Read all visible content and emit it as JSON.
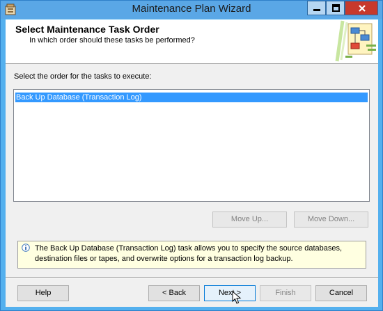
{
  "window": {
    "title": "Maintenance Plan Wizard",
    "controls": [
      {
        "name": "minimize-button",
        "icon": "minimize-icon"
      },
      {
        "name": "maximize-button",
        "icon": "maximize-icon"
      },
      {
        "name": "close-button",
        "icon": "close-icon"
      }
    ],
    "close_color": "#c7392c",
    "title_bar_color": "#5aa7e6"
  },
  "header": {
    "title": "Select Maintenance Task Order",
    "subtitle": "In which order should these tasks be performed?",
    "art_icon": "wizard-flowchart-icon"
  },
  "task_list": {
    "label": "Select the order for the tasks to execute:",
    "items": [
      {
        "label": "Back Up Database (Transaction Log)",
        "selected": true
      }
    ],
    "selection_color": "#3399ff"
  },
  "order_buttons": {
    "move_up": "Move Up...",
    "move_down": "Move Down..."
  },
  "info": {
    "icon": "info-icon",
    "text_line1": "The Back Up Database (Transaction Log) task allows you to specify the source databases,",
    "text_line2": "destination files or tapes, and overwrite options for a transaction log backup.",
    "background": "#ffffe1"
  },
  "footer": {
    "help": "Help",
    "back": "< Back",
    "next": "Next >",
    "finish": "Finish",
    "cancel": "Cancel"
  }
}
